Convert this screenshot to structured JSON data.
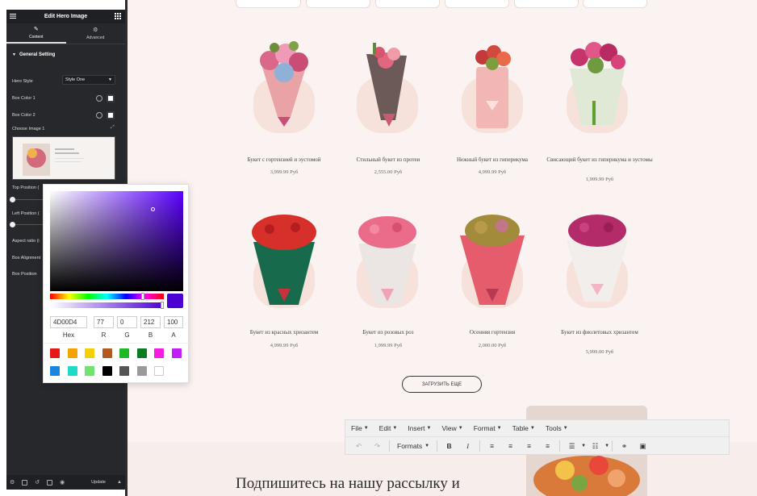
{
  "editor": {
    "title": "Edit Hero Image",
    "tabs": [
      {
        "label": "Content",
        "icon": "pencil-icon"
      },
      {
        "label": "Advanced",
        "icon": "gear-icon"
      }
    ],
    "section": "General Setting",
    "hero_style_label": "Hero Style",
    "hero_style_value": "Style One",
    "box_color_1": "Box Color 1",
    "box_color_2": "Box Color 2",
    "choose_image": "Choose Image 1",
    "top_position": "Top Position (",
    "left_position": "Left Position (",
    "aspect_ratio": "Aspect ratio (i",
    "box_alignment": "Box Alignment",
    "box_position": "Box Position",
    "update_label": "Update"
  },
  "picker": {
    "hex": "4D00D4",
    "r": "77",
    "g": "0",
    "b": "212",
    "a": "100",
    "labels": {
      "hex": "Hex",
      "r": "R",
      "g": "G",
      "b": "B",
      "a": "A"
    },
    "current_color": "#4d00d4",
    "presets": [
      "#e61919",
      "#f5a300",
      "#f5d000",
      "#b35b1e",
      "#1fb925",
      "#0f7b23",
      "#f51ee0",
      "#c31ef5",
      "#1a86e0",
      "#1fd9c9",
      "#6ee36e",
      "#000000",
      "#555555",
      "#999999",
      "#ffffff"
    ]
  },
  "products": [
    {
      "name": "Букет с гортензией и эустомой",
      "price": "3,999.99 Руб"
    },
    {
      "name": "Стильный букет из протеи",
      "price": "2,555.00 Руб"
    },
    {
      "name": "Нежный букет из гиперикума",
      "price": "4,999.99 Руб"
    },
    {
      "name": "Свисающий букет из гиперикума и эустомы",
      "price": "1,999.99 Руб"
    },
    {
      "name": "Букет из красных хризантем",
      "price": "4,999.99 Руб"
    },
    {
      "name": "Букет из розовых роз",
      "price": "1,999.99 Руб"
    },
    {
      "name": "Осенняя гортензия",
      "price": "2,000.00 Руб"
    },
    {
      "name": "Букет из фиолетовых хризантем",
      "price": "5,999.00 Руб"
    }
  ],
  "load_more": "ЗАГРУЗИТЬ ЕЩЕ",
  "newsletter_title": "Подпишитесь на нашу рассылку и",
  "tinymce": {
    "menus": [
      "File",
      "Edit",
      "Insert",
      "View",
      "Format",
      "Table",
      "Tools"
    ],
    "formats_label": "Formats"
  }
}
